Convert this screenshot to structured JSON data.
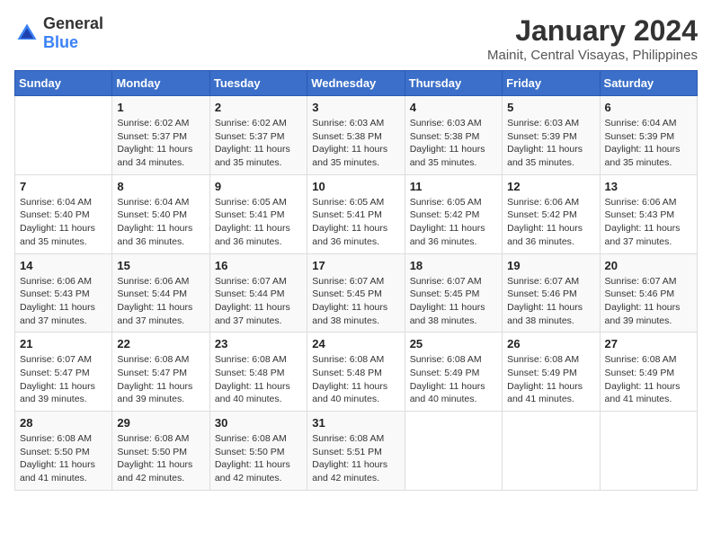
{
  "logo": {
    "general": "General",
    "blue": "Blue"
  },
  "header": {
    "month": "January 2024",
    "location": "Mainit, Central Visayas, Philippines"
  },
  "weekdays": [
    "Sunday",
    "Monday",
    "Tuesday",
    "Wednesday",
    "Thursday",
    "Friday",
    "Saturday"
  ],
  "weeks": [
    [
      {
        "day": "",
        "sunrise": "",
        "sunset": "",
        "daylight": ""
      },
      {
        "day": "1",
        "sunrise": "Sunrise: 6:02 AM",
        "sunset": "Sunset: 5:37 PM",
        "daylight": "Daylight: 11 hours and 34 minutes."
      },
      {
        "day": "2",
        "sunrise": "Sunrise: 6:02 AM",
        "sunset": "Sunset: 5:37 PM",
        "daylight": "Daylight: 11 hours and 35 minutes."
      },
      {
        "day": "3",
        "sunrise": "Sunrise: 6:03 AM",
        "sunset": "Sunset: 5:38 PM",
        "daylight": "Daylight: 11 hours and 35 minutes."
      },
      {
        "day": "4",
        "sunrise": "Sunrise: 6:03 AM",
        "sunset": "Sunset: 5:38 PM",
        "daylight": "Daylight: 11 hours and 35 minutes."
      },
      {
        "day": "5",
        "sunrise": "Sunrise: 6:03 AM",
        "sunset": "Sunset: 5:39 PM",
        "daylight": "Daylight: 11 hours and 35 minutes."
      },
      {
        "day": "6",
        "sunrise": "Sunrise: 6:04 AM",
        "sunset": "Sunset: 5:39 PM",
        "daylight": "Daylight: 11 hours and 35 minutes."
      }
    ],
    [
      {
        "day": "7",
        "sunrise": "Sunrise: 6:04 AM",
        "sunset": "Sunset: 5:40 PM",
        "daylight": "Daylight: 11 hours and 35 minutes."
      },
      {
        "day": "8",
        "sunrise": "Sunrise: 6:04 AM",
        "sunset": "Sunset: 5:40 PM",
        "daylight": "Daylight: 11 hours and 36 minutes."
      },
      {
        "day": "9",
        "sunrise": "Sunrise: 6:05 AM",
        "sunset": "Sunset: 5:41 PM",
        "daylight": "Daylight: 11 hours and 36 minutes."
      },
      {
        "day": "10",
        "sunrise": "Sunrise: 6:05 AM",
        "sunset": "Sunset: 5:41 PM",
        "daylight": "Daylight: 11 hours and 36 minutes."
      },
      {
        "day": "11",
        "sunrise": "Sunrise: 6:05 AM",
        "sunset": "Sunset: 5:42 PM",
        "daylight": "Daylight: 11 hours and 36 minutes."
      },
      {
        "day": "12",
        "sunrise": "Sunrise: 6:06 AM",
        "sunset": "Sunset: 5:42 PM",
        "daylight": "Daylight: 11 hours and 36 minutes."
      },
      {
        "day": "13",
        "sunrise": "Sunrise: 6:06 AM",
        "sunset": "Sunset: 5:43 PM",
        "daylight": "Daylight: 11 hours and 37 minutes."
      }
    ],
    [
      {
        "day": "14",
        "sunrise": "Sunrise: 6:06 AM",
        "sunset": "Sunset: 5:43 PM",
        "daylight": "Daylight: 11 hours and 37 minutes."
      },
      {
        "day": "15",
        "sunrise": "Sunrise: 6:06 AM",
        "sunset": "Sunset: 5:44 PM",
        "daylight": "Daylight: 11 hours and 37 minutes."
      },
      {
        "day": "16",
        "sunrise": "Sunrise: 6:07 AM",
        "sunset": "Sunset: 5:44 PM",
        "daylight": "Daylight: 11 hours and 37 minutes."
      },
      {
        "day": "17",
        "sunrise": "Sunrise: 6:07 AM",
        "sunset": "Sunset: 5:45 PM",
        "daylight": "Daylight: 11 hours and 38 minutes."
      },
      {
        "day": "18",
        "sunrise": "Sunrise: 6:07 AM",
        "sunset": "Sunset: 5:45 PM",
        "daylight": "Daylight: 11 hours and 38 minutes."
      },
      {
        "day": "19",
        "sunrise": "Sunrise: 6:07 AM",
        "sunset": "Sunset: 5:46 PM",
        "daylight": "Daylight: 11 hours and 38 minutes."
      },
      {
        "day": "20",
        "sunrise": "Sunrise: 6:07 AM",
        "sunset": "Sunset: 5:46 PM",
        "daylight": "Daylight: 11 hours and 39 minutes."
      }
    ],
    [
      {
        "day": "21",
        "sunrise": "Sunrise: 6:07 AM",
        "sunset": "Sunset: 5:47 PM",
        "daylight": "Daylight: 11 hours and 39 minutes."
      },
      {
        "day": "22",
        "sunrise": "Sunrise: 6:08 AM",
        "sunset": "Sunset: 5:47 PM",
        "daylight": "Daylight: 11 hours and 39 minutes."
      },
      {
        "day": "23",
        "sunrise": "Sunrise: 6:08 AM",
        "sunset": "Sunset: 5:48 PM",
        "daylight": "Daylight: 11 hours and 40 minutes."
      },
      {
        "day": "24",
        "sunrise": "Sunrise: 6:08 AM",
        "sunset": "Sunset: 5:48 PM",
        "daylight": "Daylight: 11 hours and 40 minutes."
      },
      {
        "day": "25",
        "sunrise": "Sunrise: 6:08 AM",
        "sunset": "Sunset: 5:49 PM",
        "daylight": "Daylight: 11 hours and 40 minutes."
      },
      {
        "day": "26",
        "sunrise": "Sunrise: 6:08 AM",
        "sunset": "Sunset: 5:49 PM",
        "daylight": "Daylight: 11 hours and 41 minutes."
      },
      {
        "day": "27",
        "sunrise": "Sunrise: 6:08 AM",
        "sunset": "Sunset: 5:49 PM",
        "daylight": "Daylight: 11 hours and 41 minutes."
      }
    ],
    [
      {
        "day": "28",
        "sunrise": "Sunrise: 6:08 AM",
        "sunset": "Sunset: 5:50 PM",
        "daylight": "Daylight: 11 hours and 41 minutes."
      },
      {
        "day": "29",
        "sunrise": "Sunrise: 6:08 AM",
        "sunset": "Sunset: 5:50 PM",
        "daylight": "Daylight: 11 hours and 42 minutes."
      },
      {
        "day": "30",
        "sunrise": "Sunrise: 6:08 AM",
        "sunset": "Sunset: 5:50 PM",
        "daylight": "Daylight: 11 hours and 42 minutes."
      },
      {
        "day": "31",
        "sunrise": "Sunrise: 6:08 AM",
        "sunset": "Sunset: 5:51 PM",
        "daylight": "Daylight: 11 hours and 42 minutes."
      },
      {
        "day": "",
        "sunrise": "",
        "sunset": "",
        "daylight": ""
      },
      {
        "day": "",
        "sunrise": "",
        "sunset": "",
        "daylight": ""
      },
      {
        "day": "",
        "sunrise": "",
        "sunset": "",
        "daylight": ""
      }
    ]
  ]
}
